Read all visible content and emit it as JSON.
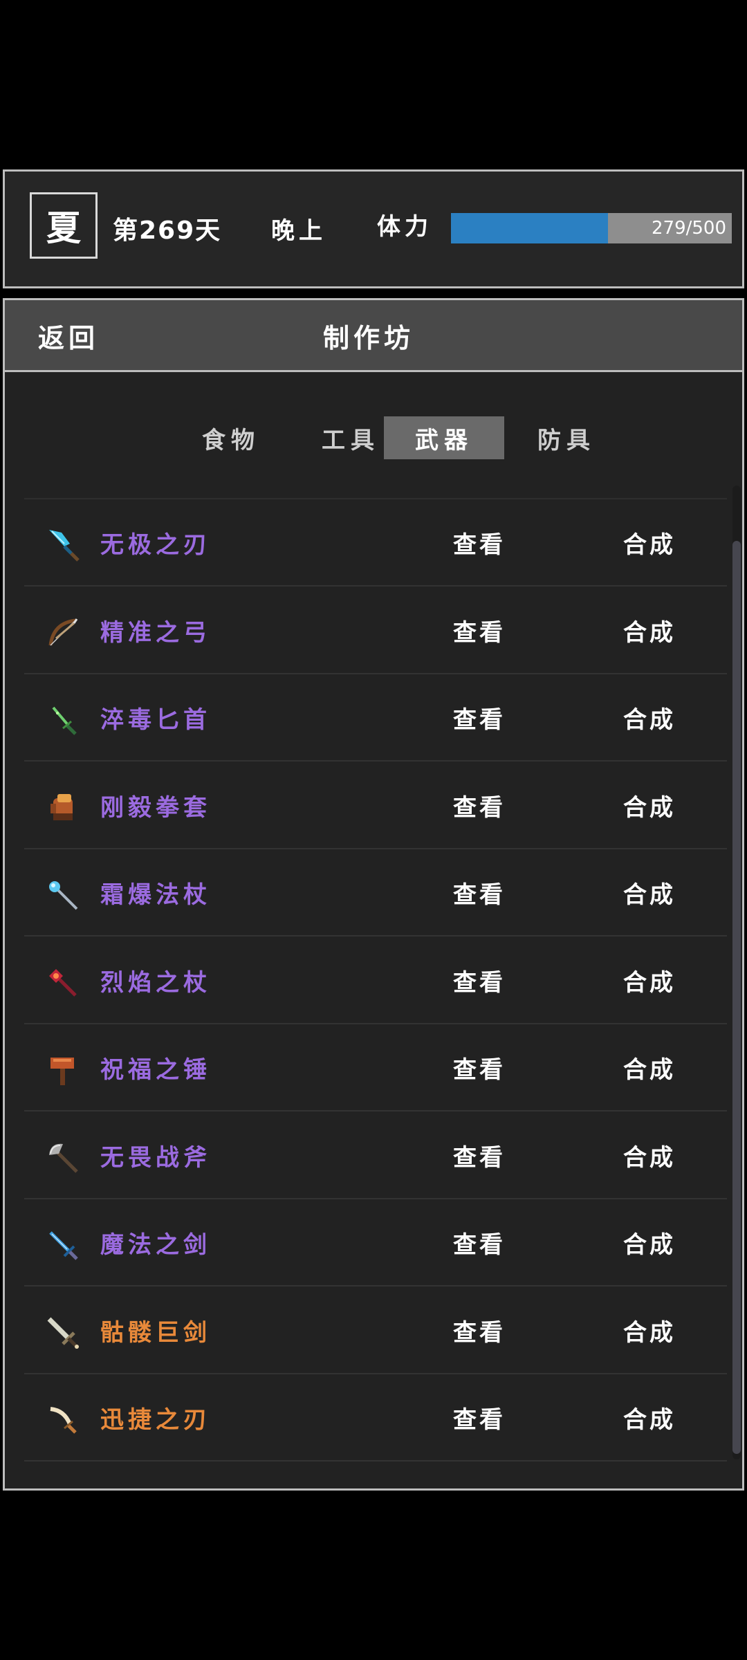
{
  "status": {
    "season": "夏",
    "day": "第269天",
    "time_of_day": "晚上",
    "stamina_label": "体力",
    "stamina_text": "279/500",
    "stamina_fraction": 0.558
  },
  "header": {
    "back_label": "返回",
    "title": "制作坊"
  },
  "tabs": [
    {
      "label": "食物",
      "active": false
    },
    {
      "label": "工具",
      "active": false
    },
    {
      "label": "武器",
      "active": true
    },
    {
      "label": "防具",
      "active": false
    }
  ],
  "items": [
    {
      "name": "无极之刃",
      "view": "查看",
      "craft": "合成",
      "name_color": "#9b6be0",
      "icon": "blue-blade-icon"
    },
    {
      "name": "精准之弓",
      "view": "查看",
      "craft": "合成",
      "name_color": "#9b6be0",
      "icon": "bow-icon"
    },
    {
      "name": "淬毒匕首",
      "view": "查看",
      "craft": "合成",
      "name_color": "#9b6be0",
      "icon": "poison-dagger-icon"
    },
    {
      "name": "刚毅拳套",
      "view": "查看",
      "craft": "合成",
      "name_color": "#9b6be0",
      "icon": "gauntlet-icon"
    },
    {
      "name": "霜爆法杖",
      "view": "查看",
      "craft": "合成",
      "name_color": "#9b6be0",
      "icon": "frost-staff-icon"
    },
    {
      "name": "烈焰之杖",
      "view": "查看",
      "craft": "合成",
      "name_color": "#9b6be0",
      "icon": "flame-staff-icon"
    },
    {
      "name": "祝福之锤",
      "view": "查看",
      "craft": "合成",
      "name_color": "#9b6be0",
      "icon": "hammer-icon"
    },
    {
      "name": "无畏战斧",
      "view": "查看",
      "craft": "合成",
      "name_color": "#9b6be0",
      "icon": "battle-axe-icon"
    },
    {
      "name": "魔法之剑",
      "view": "查看",
      "craft": "合成",
      "name_color": "#9b6be0",
      "icon": "magic-sword-icon"
    },
    {
      "name": "骷髅巨剑",
      "view": "查看",
      "craft": "合成",
      "name_color": "#e8893a",
      "icon": "greatsword-icon"
    },
    {
      "name": "迅捷之刃",
      "view": "查看",
      "craft": "合成",
      "name_color": "#e8893a",
      "icon": "swift-blade-icon"
    }
  ],
  "colors": {
    "stamina_fill": "#2b80c2",
    "epic": "#9b6be0",
    "legendary": "#e8893a"
  }
}
